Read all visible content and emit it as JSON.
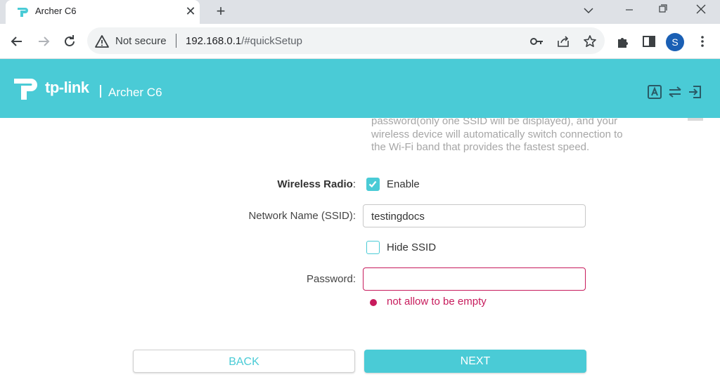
{
  "browser": {
    "tab_title": "Archer C6",
    "tab_close": "✕",
    "new_tab": "+",
    "not_secure": "Not secure",
    "url_host": "192.168.0.1",
    "url_path": "/#quickSetup",
    "profile_initial": "S"
  },
  "header": {
    "logo_text": "tp-link",
    "model": "Archer C6",
    "icons": [
      "language-icon",
      "switch-mode-icon",
      "logout-icon"
    ]
  },
  "wireless": {
    "description": "password(only one SSID will be displayed), and your wireless device will automatically switch connection to the Wi-Fi band that provides the fastest speed.",
    "radio_label": "Wireless Radio",
    "radio_colon": ":",
    "enable_label": "Enable",
    "enable_checked": true,
    "ssid_label": "Network Name (SSID):",
    "ssid_value": "testingdocs",
    "hide_ssid_label": "Hide SSID",
    "hide_ssid_checked": false,
    "password_label": "Password:",
    "password_value": "",
    "error_text": "not allow to be empty"
  },
  "buttons": {
    "back": "BACK",
    "next": "NEXT"
  },
  "colors": {
    "accent": "#4acbd6",
    "error": "#c71b5c"
  }
}
